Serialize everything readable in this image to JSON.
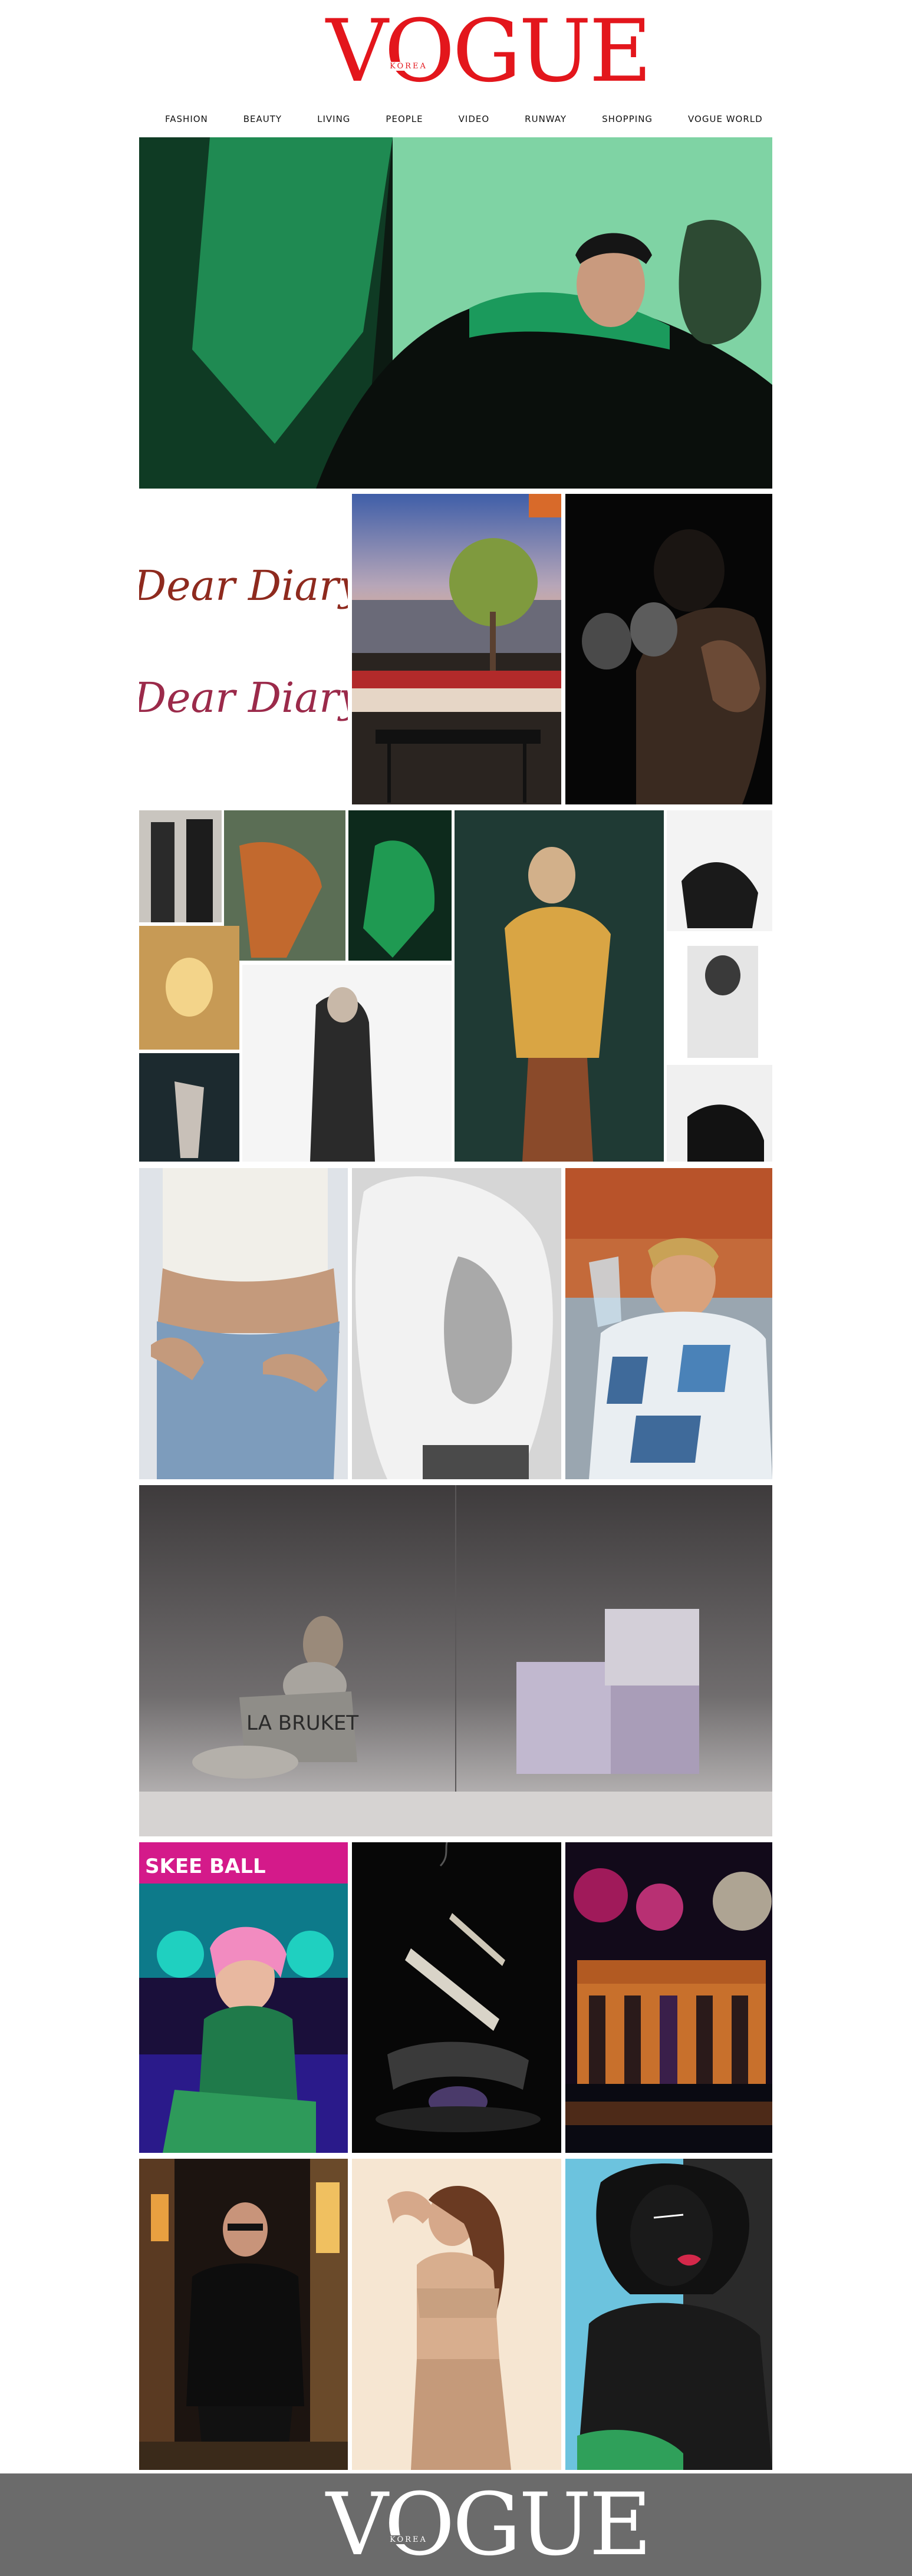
{
  "brand": {
    "name": "VOGUE",
    "edition": "KOREA",
    "accent_color": "#e3161c",
    "footer_bg": "#6b6b6b"
  },
  "nav": {
    "items": [
      {
        "label": "FASHION"
      },
      {
        "label": "BEAUTY"
      },
      {
        "label": "LIVING"
      },
      {
        "label": "PEOPLE"
      },
      {
        "label": "VIDEO"
      },
      {
        "label": "RUNWAY"
      },
      {
        "label": "SHOPPING"
      },
      {
        "label": "VOGUE WORLD"
      }
    ]
  },
  "tiles": {
    "hero": {
      "label": "man in green and black outfit with knit mitten",
      "art_text": ""
    },
    "dear_diary": {
      "art_text": "Dear Diary"
    },
    "rooftop": {
      "label": "rooftop terrace with olive tree at sunset"
    },
    "boxer": {
      "label": "boxer with gloves in the dark"
    },
    "collage": {
      "label": "fashion photo collage"
    },
    "jeans": {
      "label": "denim jeans with belly chain"
    },
    "curly_hair": {
      "label": "black and white curly hair portrait"
    },
    "printed_shirt": {
      "label": "woman in printed shirt drinking"
    },
    "soap": {
      "art_text": "LA BRUKET"
    },
    "arcade": {
      "art_text": "SKEE BALL"
    },
    "incense": {
      "label": "incense still life"
    },
    "fireworks": {
      "label": "fireworks over Brandenburg Gate"
    },
    "designer": {
      "label": "man in black suit on city street at night"
    },
    "model": {
      "label": "model in nude lingerie"
    },
    "illustration": {
      "label": "illustrated woman portrait"
    }
  }
}
